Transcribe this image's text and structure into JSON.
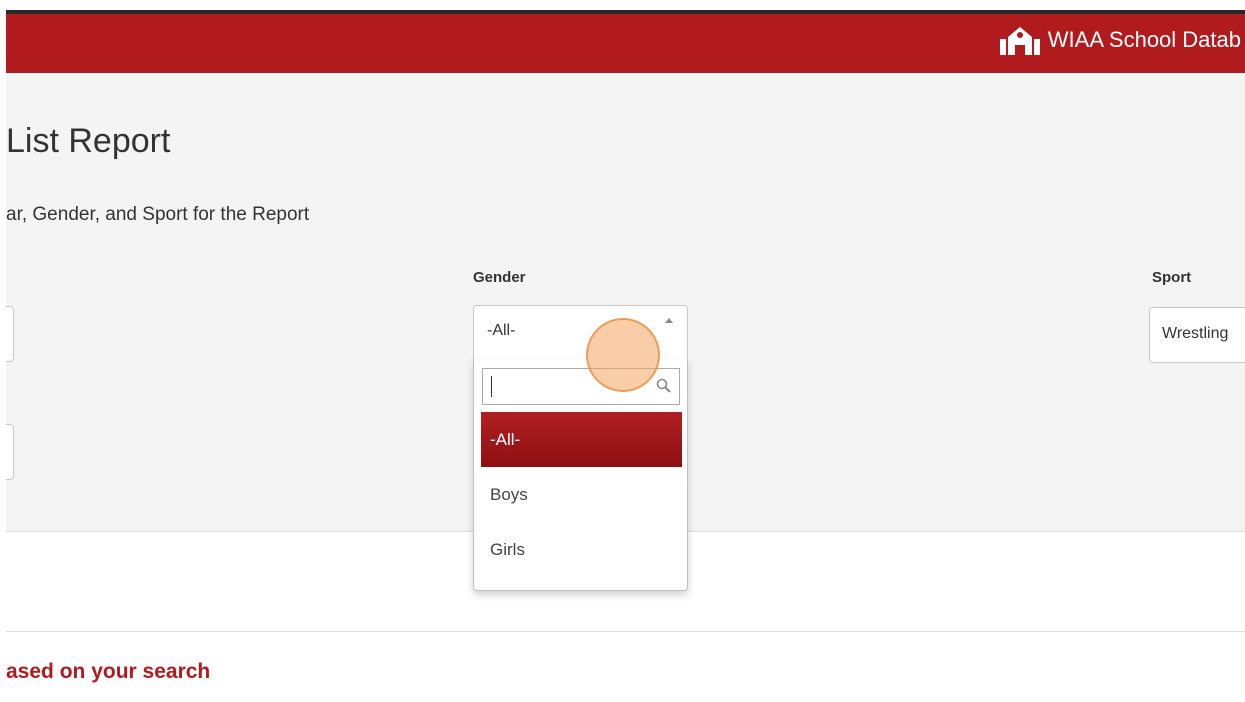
{
  "header": {
    "brand_text": "WIAA School Datab",
    "brand_icon": "school-building-icon",
    "background_color": "#b21b1e"
  },
  "page": {
    "title": "List Report",
    "subtitle": "ar, Gender, and Sport for the Report"
  },
  "filters": {
    "gender": {
      "label": "Gender",
      "selected_value": "-All-",
      "dropdown_open": true,
      "search_placeholder": "",
      "options": [
        "-All-",
        "Boys",
        "Girls"
      ]
    },
    "sport": {
      "label": "Sport",
      "selected_value": "Wrestling"
    }
  },
  "results": {
    "heading": "ased on your search"
  },
  "colors": {
    "accent": "#b21b1e",
    "selected_option": "#a0181b",
    "click_marker": "#f4a460"
  }
}
